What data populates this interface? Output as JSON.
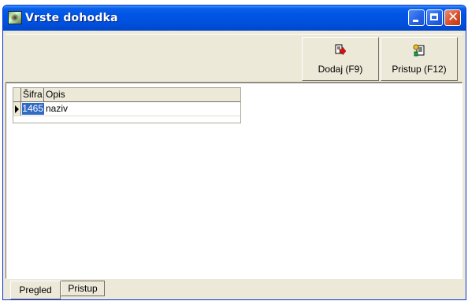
{
  "window": {
    "title": "Vrste dohodka",
    "icon": "app-icon"
  },
  "toolbar": {
    "add_label": "Dodaj (F9)",
    "add_icon": "add-document-arrow-icon",
    "access_label": "Pristup (F12)",
    "access_icon": "access-document-icon"
  },
  "grid": {
    "columns": [
      "Šifra",
      "Opis"
    ],
    "rows": [
      {
        "sifra": "1465",
        "opis": "naziv",
        "selected": true
      }
    ]
  },
  "tabs": [
    {
      "label": "Pregled",
      "active": true
    },
    {
      "label": "Pristup",
      "active": false
    }
  ],
  "colors": {
    "titlebar": "#0054E3",
    "selection": "#316AC5",
    "face": "#ECE9D8"
  }
}
